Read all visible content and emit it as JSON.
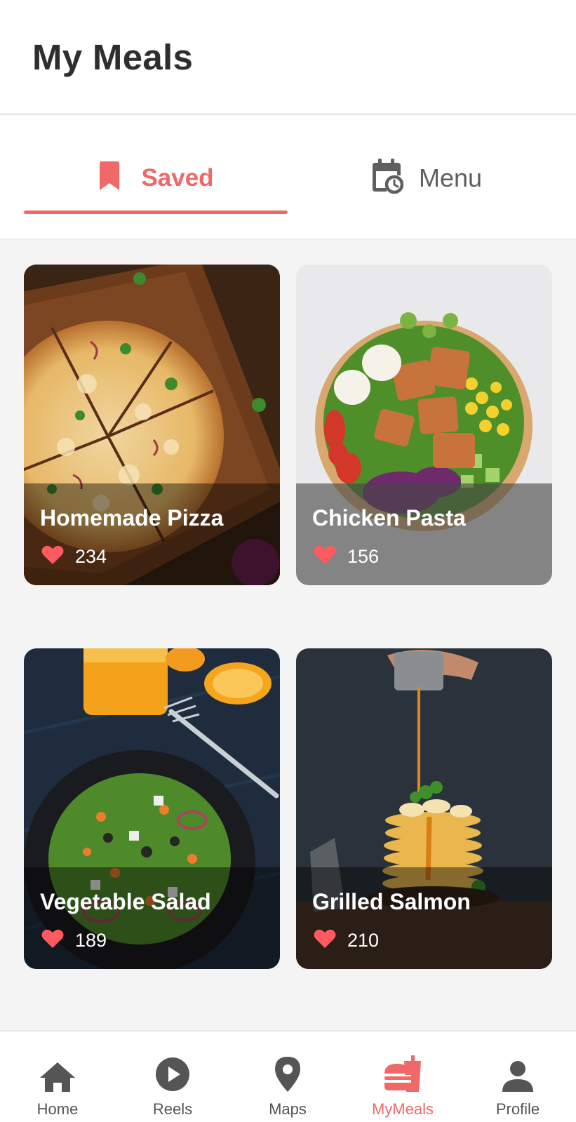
{
  "header": {
    "title": "My Meals"
  },
  "tabs": [
    {
      "label": "Saved",
      "icon": "bookmark-icon",
      "active": true
    },
    {
      "label": "Menu",
      "icon": "calendar-clock-icon",
      "active": false
    }
  ],
  "meals": [
    {
      "title": "Homemade Pizza",
      "likes": "234",
      "image": "pizza-photo"
    },
    {
      "title": "Chicken Pasta",
      "likes": "156",
      "image": "chicken-bowl-photo"
    },
    {
      "title": "Vegetable Salad",
      "likes": "189",
      "image": "salad-photo"
    },
    {
      "title": "Grilled Salmon",
      "likes": "210",
      "image": "pancakes-photo"
    }
  ],
  "bottom_nav": [
    {
      "label": "Home",
      "icon": "home-icon"
    },
    {
      "label": "Reels",
      "icon": "play-circle-icon"
    },
    {
      "label": "Maps",
      "icon": "map-pin-icon"
    },
    {
      "label": "MyMeals",
      "icon": "meals-icon",
      "active": true
    },
    {
      "label": "Profile",
      "icon": "person-icon"
    }
  ],
  "colors": {
    "accent": "#f06868",
    "heart": "#ff5a5f",
    "text_dark": "#2e2e2e",
    "nav_inactive": "#555555",
    "background": "#f4f4f4"
  }
}
